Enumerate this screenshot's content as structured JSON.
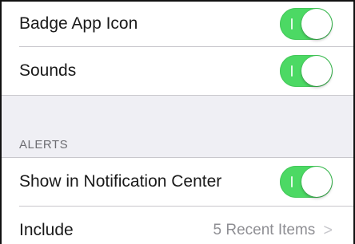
{
  "top_group": {
    "rows": [
      {
        "label": "Badge App Icon",
        "toggle_on": true
      },
      {
        "label": "Sounds",
        "toggle_on": true
      }
    ]
  },
  "alerts_section": {
    "header": "ALERTS",
    "rows": [
      {
        "label": "Show in Notification Center",
        "toggle_on": true
      },
      {
        "label": "Include",
        "value": "5 Recent Items",
        "chevron": ">"
      }
    ]
  },
  "colors": {
    "toggle_on": "#4cd964",
    "background": "#efeff4",
    "secondary_text": "#8e8e93"
  },
  "icons": [
    "chevron-right-icon"
  ]
}
